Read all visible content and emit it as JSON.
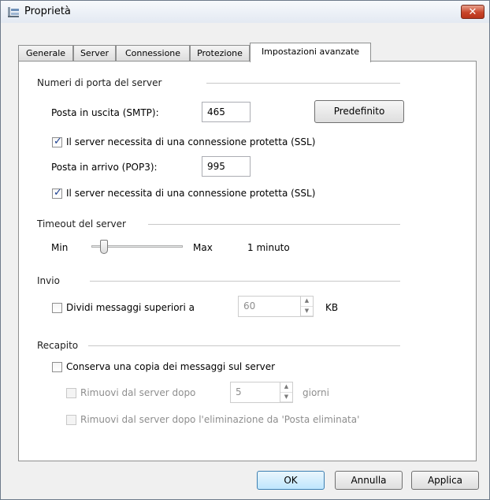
{
  "window": {
    "title": "Proprietà"
  },
  "tabs": [
    "Generale",
    "Server",
    "Connessione",
    "Protezione",
    "Impostazioni avanzate"
  ],
  "ports": {
    "group_label": "Numeri di porta del server",
    "smtp_label": "Posta in uscita (SMTP):",
    "smtp_value": "465",
    "default_button": "Predefinito",
    "smtp_ssl_label": "Il server necessita di una connessione protetta (SSL)",
    "smtp_ssl_checked": true,
    "pop3_label": "Posta in arrivo (POP3):",
    "pop3_value": "995",
    "pop3_ssl_label": "Il server necessita di una connessione protetta (SSL)",
    "pop3_ssl_checked": true
  },
  "timeout": {
    "group_label": "Timeout del server",
    "min_label": "Min",
    "max_label": "Max",
    "value_text": "1 minuto"
  },
  "send": {
    "group_label": "Invio",
    "split_label": "Dividi messaggi superiori a",
    "split_checked": false,
    "split_value": "60",
    "split_unit": "KB"
  },
  "delivery": {
    "group_label": "Recapito",
    "keep_copy_label": "Conserva una copia dei messaggi sul server",
    "keep_copy_checked": false,
    "remove_after_label": "Rimuovi dal server dopo",
    "remove_after_value": "5",
    "remove_after_unit": "giorni",
    "remove_deleted_label": "Rimuovi dal server dopo l'eliminazione da 'Posta eliminata'"
  },
  "buttons": {
    "ok": "OK",
    "cancel": "Annulla",
    "apply": "Applica"
  }
}
